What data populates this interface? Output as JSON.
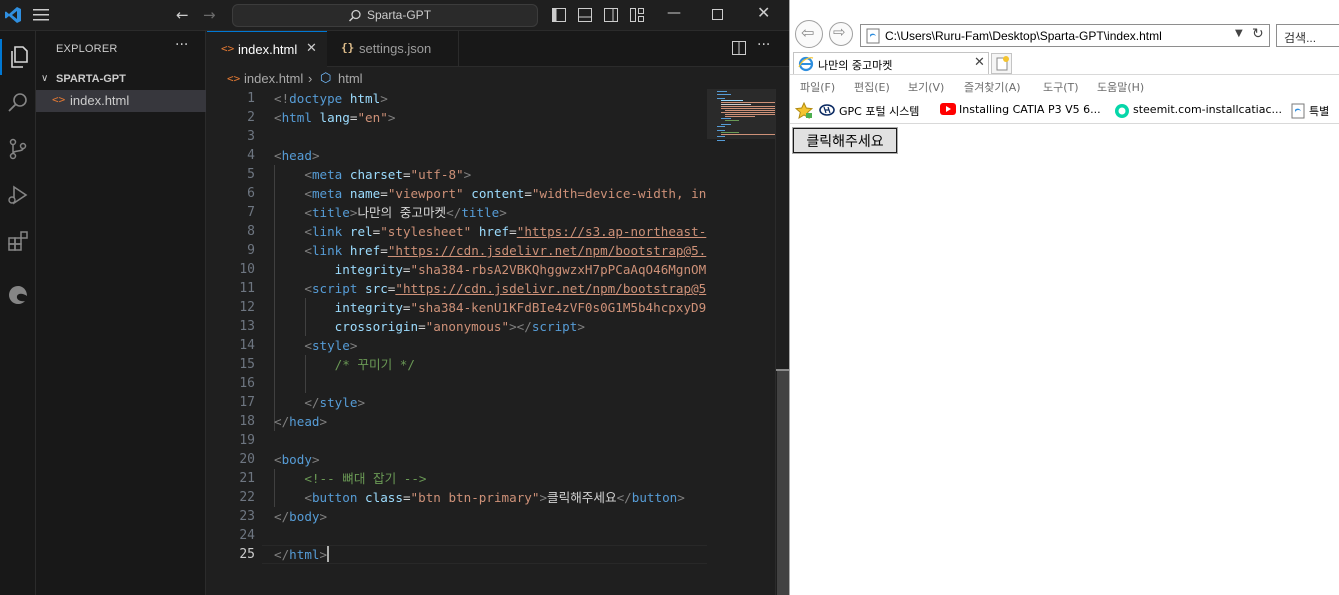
{
  "vscode": {
    "command_center": "Sparta-GPT",
    "explorer": {
      "title": "EXPLORER",
      "folder": "SPARTA-GPT",
      "files": [
        "index.html"
      ]
    },
    "tabs": [
      {
        "label": "index.html",
        "active": true
      },
      {
        "label": "settings.json",
        "active": false
      }
    ],
    "breadcrumb": {
      "file": "index.html",
      "node": "html"
    },
    "line_numbers": [
      "1",
      "2",
      "3",
      "4",
      "5",
      "6",
      "7",
      "8",
      "9",
      "10",
      "11",
      "12",
      "13",
      "14",
      "15",
      "16",
      "17",
      "18",
      "19",
      "20",
      "21",
      "22",
      "23",
      "24",
      "25"
    ],
    "current_line": "25",
    "code": {
      "doctype": "doctype",
      "lang": "\"en\"",
      "charset": "\"utf-8\"",
      "viewport_name": "\"viewport\"",
      "viewport_content": "\"width=device-width, in",
      "title_text": "나만의 중고마켓",
      "link1_rel": "\"stylesheet\"",
      "link1_href": "\"https://s3.ap-northeast-",
      "link2_href": "\"https://cdn.jsdelivr.net/npm/bootstrap@5.",
      "link2_integrity": "\"sha384-rbsA2VBKQhggwzxH7pPCaAqO46MgnOM",
      "script_src": "\"https://cdn.jsdelivr.net/npm/bootstrap@5",
      "script_integrity": "\"sha384-kenU1KFdBIe4zVF0s0G1M5b4hcpxyD9",
      "script_crossorigin": "\"anonymous\"",
      "style_comment": "/* 꾸미기 */",
      "body_comment": "<!-- 뼈대 잡기 -->",
      "button_class": "\"btn btn-primary\"",
      "button_text": "클릭해주세요"
    }
  },
  "ie": {
    "address": "C:\\Users\\Ruru-Fam\\Desktop\\Sparta-GPT\\index.html",
    "search_placeholder": "검색...",
    "tab_title": "나만의 중고마켓",
    "menu": [
      "파일(F)",
      "편집(E)",
      "보기(V)",
      "즐겨찾기(A)",
      "도구(T)",
      "도움말(H)"
    ],
    "favorites": [
      "GPC 포털 시스템",
      "Installing CATIA P3 V5 6...",
      "steemit.com-installcatiac...",
      "특별 "
    ],
    "page_button": "클릭해주세요"
  },
  "colors": {
    "accent": "#0078d4",
    "editor_bg": "#1f1f1f",
    "tag": "#569cd6",
    "attr": "#9cdcfe",
    "string": "#ce9178",
    "comment": "#6a9955"
  }
}
